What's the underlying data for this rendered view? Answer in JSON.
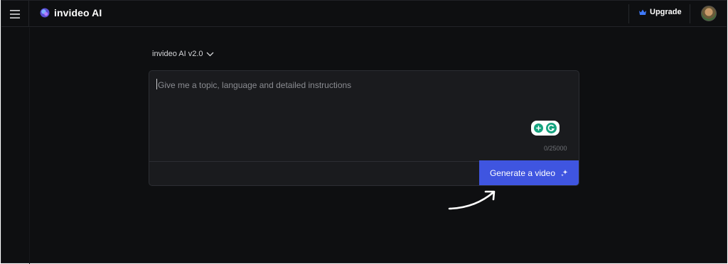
{
  "header": {
    "app_name": "invideo AI",
    "upgrade_label": "Upgrade"
  },
  "composer": {
    "version_label": "invideo AI v2.0",
    "placeholder": "Give me a topic, language and detailed instructions",
    "char_counter": "0/25000",
    "generate_label": "Generate a video"
  },
  "icons": {
    "menu": "hamburger-menu-icon",
    "logo": "invideo-logo-icon",
    "upgrade": "crown-icon",
    "version": "chevron-down-icon",
    "grammarly": "grammarly-icon",
    "generate": "sparkle-icon",
    "annotation": "curved-arrow-icon"
  },
  "colors": {
    "background": "#0e0f11",
    "card": "#1a1b1e",
    "accent": "#3f55e0",
    "upgrade_crown": "#3f7bff"
  }
}
